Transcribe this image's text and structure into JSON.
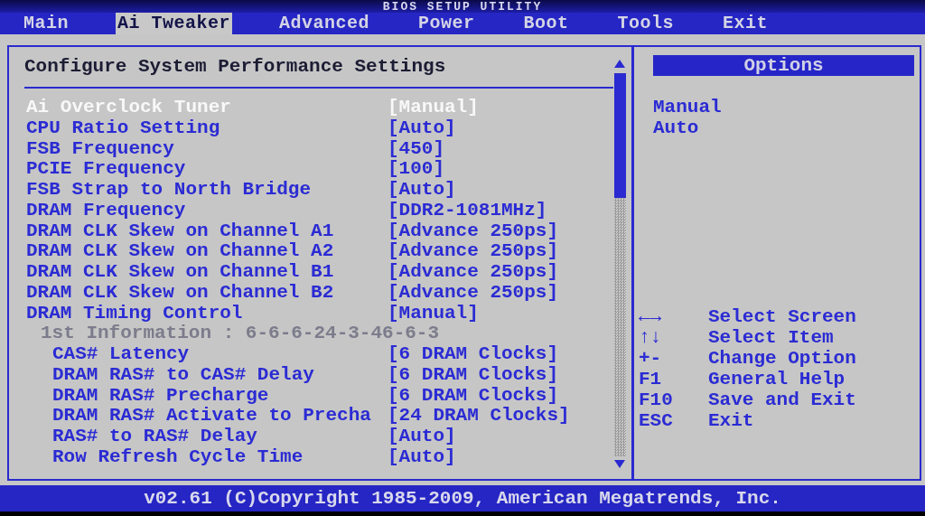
{
  "title_bar": {
    "title": "BIOS SETUP UTILITY"
  },
  "menu": [
    {
      "label": "Main",
      "selected": false
    },
    {
      "label": "Ai Tweaker",
      "selected": true
    },
    {
      "label": "Advanced",
      "selected": false
    },
    {
      "label": "Power",
      "selected": false
    },
    {
      "label": "Boot",
      "selected": false
    },
    {
      "label": "Tools",
      "selected": false
    },
    {
      "label": "Exit",
      "selected": false
    }
  ],
  "settings_panel": {
    "heading": "Configure System Performance Settings",
    "items": [
      {
        "kind": "setting",
        "label": "Ai Overclock Tuner",
        "value": "[Manual]",
        "selected": true
      },
      {
        "kind": "setting",
        "label": "CPU Ratio Setting",
        "value": "[Auto]",
        "selected": false
      },
      {
        "kind": "setting",
        "label": "FSB Frequency",
        "value": "[450]",
        "selected": false
      },
      {
        "kind": "setting",
        "label": "PCIE Frequency",
        "value": "[100]",
        "selected": false
      },
      {
        "kind": "setting",
        "label": "FSB Strap to North Bridge",
        "value": "[Auto]",
        "selected": false
      },
      {
        "kind": "setting",
        "label": "DRAM Frequency",
        "value": "[DDR2-1081MHz]",
        "selected": false
      },
      {
        "kind": "setting",
        "label": "DRAM CLK Skew on Channel A1",
        "value": "[Advance 250ps]",
        "selected": false
      },
      {
        "kind": "setting",
        "label": "DRAM CLK Skew on Channel A2",
        "value": "[Advance 250ps]",
        "selected": false
      },
      {
        "kind": "setting",
        "label": "DRAM CLK Skew on Channel B1",
        "value": "[Advance 250ps]",
        "selected": false
      },
      {
        "kind": "setting",
        "label": "DRAM CLK Skew on Channel B2",
        "value": "[Advance 250ps]",
        "selected": false
      },
      {
        "kind": "setting",
        "label": "DRAM Timing Control",
        "value": "[Manual]",
        "selected": false,
        "children": [
          {
            "kind": "info",
            "label": "1st Information : 6-6-6-24-3-46-6-3"
          },
          {
            "kind": "setting",
            "label": "CAS# Latency",
            "value": "[6 DRAM Clocks]",
            "selected": false
          },
          {
            "kind": "setting",
            "label": "DRAM RAS# to CAS# Delay",
            "value": "[6 DRAM Clocks]",
            "selected": false
          },
          {
            "kind": "setting",
            "label": "DRAM RAS# Precharge",
            "value": "[6 DRAM Clocks]",
            "selected": false
          },
          {
            "kind": "setting",
            "label": "DRAM RAS# Activate to Precha",
            "value": "[24 DRAM Clocks]",
            "selected": false
          },
          {
            "kind": "setting",
            "label": "RAS# to RAS# Delay",
            "value": "[Auto]",
            "selected": false
          },
          {
            "kind": "setting",
            "label": "Row Refresh Cycle Time",
            "value": "[Auto]",
            "selected": false
          }
        ]
      }
    ]
  },
  "options_panel": {
    "title": "Options",
    "options": [
      "Manual",
      "Auto"
    ]
  },
  "key_legend": [
    {
      "key": "←→",
      "action": "Select Screen"
    },
    {
      "key": "↑↓",
      "action": "Select Item"
    },
    {
      "key": "+-",
      "action": "Change Option"
    },
    {
      "key": "F1",
      "action": "General Help"
    },
    {
      "key": "F10",
      "action": "Save and Exit"
    },
    {
      "key": "ESC",
      "action": "Exit"
    }
  ],
  "status_bar": {
    "text": "v02.61 (C)Copyright 1985-2009, American Megatrends, Inc."
  }
}
